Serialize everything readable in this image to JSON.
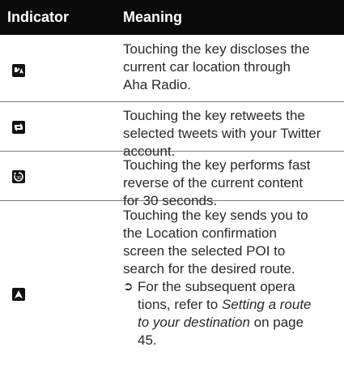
{
  "table": {
    "col_indicator": "Indicator",
    "col_meaning": "Meaning",
    "rows": [
      {
        "icon": "location-share-icon",
        "lines": [
          "Touching the key discloses the",
          "current car location through",
          "Aha Radio."
        ]
      },
      {
        "icon": "retweet-icon",
        "lines": [
          "Touching the key retweets the",
          "selected tweets with your Twitter",
          "account."
        ]
      },
      {
        "icon": "rewind-30-icon",
        "lines": [
          "Touching the key performs fast",
          "reverse of the current content",
          "for 30 seconds."
        ]
      },
      {
        "icon": "navigate-arrow-icon",
        "lines": [
          "Touching the key sends you to",
          "the Location confirmation",
          "screen the selected POI to",
          "search for the desired route."
        ],
        "note": {
          "bullet": "➲",
          "line1": "For the subsequent opera",
          "line2": "tions, refer to ",
          "link_italic_1": "Setting a route",
          "link_italic_2": "to your destination",
          "after_link": " on page",
          "page": "45."
        }
      }
    ]
  }
}
